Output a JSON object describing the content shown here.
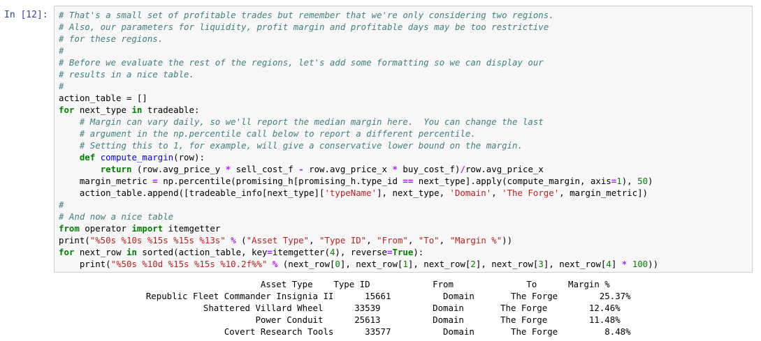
{
  "cell": {
    "prompt": "In [12]:",
    "code_lines": [
      [
        {
          "t": "comment",
          "s": "# That's a small set of profitable trades but remember that we're only considering two regions."
        }
      ],
      [
        {
          "t": "comment",
          "s": "# Also, our parameters for liquidity, profit margin and profitable days may be too restrictive"
        }
      ],
      [
        {
          "t": "comment",
          "s": "# for these regions."
        }
      ],
      [
        {
          "t": "comment",
          "s": "#"
        }
      ],
      [
        {
          "t": "comment",
          "s": "# Before we evaluate the rest of the regions, let's add some formatting so we can display our"
        }
      ],
      [
        {
          "t": "comment",
          "s": "# results in a nice table."
        }
      ],
      [
        {
          "t": "comment",
          "s": "#"
        }
      ],
      [
        {
          "t": "plain",
          "s": "action_table = []"
        }
      ],
      [
        {
          "t": "keyword",
          "s": "for"
        },
        {
          "t": "plain",
          "s": " next_type "
        },
        {
          "t": "keyword",
          "s": "in"
        },
        {
          "t": "plain",
          "s": " tradeable:"
        }
      ],
      [
        {
          "t": "plain",
          "s": "    "
        },
        {
          "t": "comment",
          "s": "# Margin can vary daily, so we'll report the median margin here.  You can change the last"
        }
      ],
      [
        {
          "t": "plain",
          "s": "    "
        },
        {
          "t": "comment",
          "s": "# argument in the np.percentile call below to report a different percentile."
        }
      ],
      [
        {
          "t": "plain",
          "s": "    "
        },
        {
          "t": "comment",
          "s": "# Setting this to 1, for example, will give a conservative lower bound on the margin."
        }
      ],
      [
        {
          "t": "plain",
          "s": "    "
        },
        {
          "t": "keyword",
          "s": "def"
        },
        {
          "t": "plain",
          "s": " "
        },
        {
          "t": "funcname",
          "s": "compute_margin"
        },
        {
          "t": "plain",
          "s": "(row):"
        }
      ],
      [
        {
          "t": "plain",
          "s": "        "
        },
        {
          "t": "keyword",
          "s": "return"
        },
        {
          "t": "plain",
          "s": " (row.avg_price_y "
        },
        {
          "t": "operator",
          "s": "*"
        },
        {
          "t": "plain",
          "s": " sell_cost_f "
        },
        {
          "t": "operator",
          "s": "-"
        },
        {
          "t": "plain",
          "s": " row.avg_price_x "
        },
        {
          "t": "operator",
          "s": "*"
        },
        {
          "t": "plain",
          "s": " buy_cost_f)"
        },
        {
          "t": "operator",
          "s": "/"
        },
        {
          "t": "plain",
          "s": "row.avg_price_x"
        }
      ],
      [
        {
          "t": "plain",
          "s": "    margin_metric "
        },
        {
          "t": "operator",
          "s": "="
        },
        {
          "t": "plain",
          "s": " np.percentile(promising_h[promising_h.type_id "
        },
        {
          "t": "operator",
          "s": "=="
        },
        {
          "t": "plain",
          "s": " next_type].apply(compute_margin, axis"
        },
        {
          "t": "operator",
          "s": "="
        },
        {
          "t": "number",
          "s": "1"
        },
        {
          "t": "plain",
          "s": "), "
        },
        {
          "t": "number",
          "s": "50"
        },
        {
          "t": "plain",
          "s": ")"
        }
      ],
      [
        {
          "t": "plain",
          "s": "    action_table.append([tradeable_info[next_type]["
        },
        {
          "t": "string",
          "s": "'typeName'"
        },
        {
          "t": "plain",
          "s": "], next_type, "
        },
        {
          "t": "string",
          "s": "'Domain'"
        },
        {
          "t": "plain",
          "s": ", "
        },
        {
          "t": "string",
          "s": "'The Forge'"
        },
        {
          "t": "plain",
          "s": ", margin_metric])"
        }
      ],
      [
        {
          "t": "comment",
          "s": "#"
        }
      ],
      [
        {
          "t": "comment",
          "s": "# And now a nice table"
        }
      ],
      [
        {
          "t": "keyword",
          "s": "from"
        },
        {
          "t": "plain",
          "s": " operator "
        },
        {
          "t": "keyword",
          "s": "import"
        },
        {
          "t": "plain",
          "s": " itemgetter"
        }
      ],
      [
        {
          "t": "plain",
          "s": "print("
        },
        {
          "t": "string",
          "s": "\"%50s %10s %15s %15s %13s\""
        },
        {
          "t": "plain",
          "s": " "
        },
        {
          "t": "operator",
          "s": "%"
        },
        {
          "t": "plain",
          "s": " ("
        },
        {
          "t": "string",
          "s": "\"Asset Type\""
        },
        {
          "t": "plain",
          "s": ", "
        },
        {
          "t": "string",
          "s": "\"Type ID\""
        },
        {
          "t": "plain",
          "s": ", "
        },
        {
          "t": "string",
          "s": "\"From\""
        },
        {
          "t": "plain",
          "s": ", "
        },
        {
          "t": "string",
          "s": "\"To\""
        },
        {
          "t": "plain",
          "s": ", "
        },
        {
          "t": "string",
          "s": "\"Margin %\""
        },
        {
          "t": "plain",
          "s": "))"
        }
      ],
      [
        {
          "t": "keyword",
          "s": "for"
        },
        {
          "t": "plain",
          "s": " next_row "
        },
        {
          "t": "keyword",
          "s": "in"
        },
        {
          "t": "plain",
          "s": " sorted(action_table, key"
        },
        {
          "t": "operator",
          "s": "="
        },
        {
          "t": "plain",
          "s": "itemgetter("
        },
        {
          "t": "number",
          "s": "4"
        },
        {
          "t": "plain",
          "s": "), reverse"
        },
        {
          "t": "operator",
          "s": "="
        },
        {
          "t": "keyword",
          "s": "True"
        },
        {
          "t": "plain",
          "s": "):"
        }
      ],
      [
        {
          "t": "plain",
          "s": "    print("
        },
        {
          "t": "string",
          "s": "\"%50s %10d %15s %15s %10.2f%%\""
        },
        {
          "t": "plain",
          "s": " "
        },
        {
          "t": "operator",
          "s": "%"
        },
        {
          "t": "plain",
          "s": " (next_row["
        },
        {
          "t": "number",
          "s": "0"
        },
        {
          "t": "plain",
          "s": "], next_row["
        },
        {
          "t": "number",
          "s": "1"
        },
        {
          "t": "plain",
          "s": "], next_row["
        },
        {
          "t": "number",
          "s": "2"
        },
        {
          "t": "plain",
          "s": "], next_row["
        },
        {
          "t": "number",
          "s": "3"
        },
        {
          "t": "plain",
          "s": "], next_row["
        },
        {
          "t": "number",
          "s": "4"
        },
        {
          "t": "plain",
          "s": "] "
        },
        {
          "t": "operator",
          "s": "*"
        },
        {
          "t": "plain",
          "s": " "
        },
        {
          "t": "number",
          "s": "100"
        },
        {
          "t": "plain",
          "s": "))"
        }
      ]
    ],
    "output_lines": [
      "                                       Asset Type    Type ID            From              To      Margin %",
      "                 Republic Fleet Commander Insignia II      15661          Domain       The Forge        25.37%",
      "                            Shattered Villard Wheel      33539          Domain       The Forge        12.46%",
      "                                      Power Conduit      25613          Domain       The Forge        11.48%",
      "                                Covert Research Tools      33577          Domain       The Forge         8.48%"
    ]
  }
}
